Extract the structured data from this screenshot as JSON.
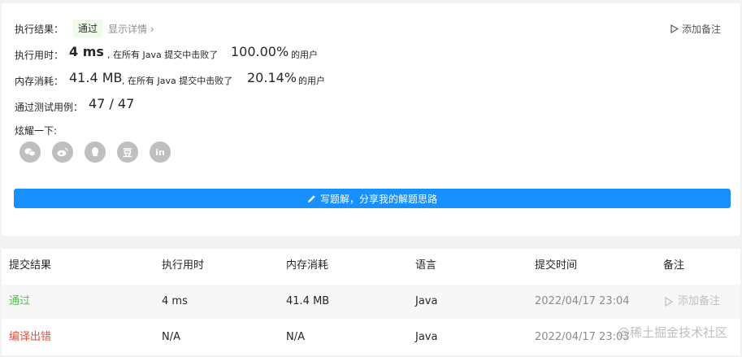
{
  "result": {
    "exec_label": "执行结果：",
    "status": "通过",
    "detail_link": "显示详情",
    "add_note": "添加备注",
    "runtime_label": "执行用时：",
    "runtime_value": "4 ms",
    "runtime_mid": ", 在所有 Java 提交中击败了",
    "runtime_pct": "100.00%",
    "runtime_suffix": "的用户",
    "memory_label": "内存消耗：",
    "memory_value": "41.4 MB",
    "memory_mid": ", 在所有 Java 提交中击败了",
    "memory_pct": "20.14%",
    "memory_suffix": "的用户",
    "tests_label": "通过测试用例：",
    "tests_value": "47 / 47",
    "share_label": "炫耀一下:",
    "share_icons": [
      "wechat-icon",
      "weibo-icon",
      "qq-icon",
      "douban-icon",
      "linkedin-icon"
    ],
    "douban_glyph": "豆",
    "linkedin_glyph": "in",
    "solution_button": "写题解，分享我的解题思路"
  },
  "table": {
    "headers": [
      "提交结果",
      "执行用时",
      "内存消耗",
      "语言",
      "提交时间",
      "备注"
    ],
    "rows": [
      {
        "status": "通过",
        "runtime": "4 ms",
        "memory": "41.4 MB",
        "lang": "Java",
        "time": "2022/04/17 23:04",
        "note": "添加备注"
      },
      {
        "status": "编译出错",
        "runtime": "N/A",
        "memory": "N/A",
        "lang": "Java",
        "time": "2022/04/17 23:03",
        "note": ""
      }
    ]
  },
  "watermark": "@稀土掘金技术社区",
  "colors": {
    "pass": "#5cb85c",
    "error": "#e0523b",
    "accent": "#1890ff"
  }
}
